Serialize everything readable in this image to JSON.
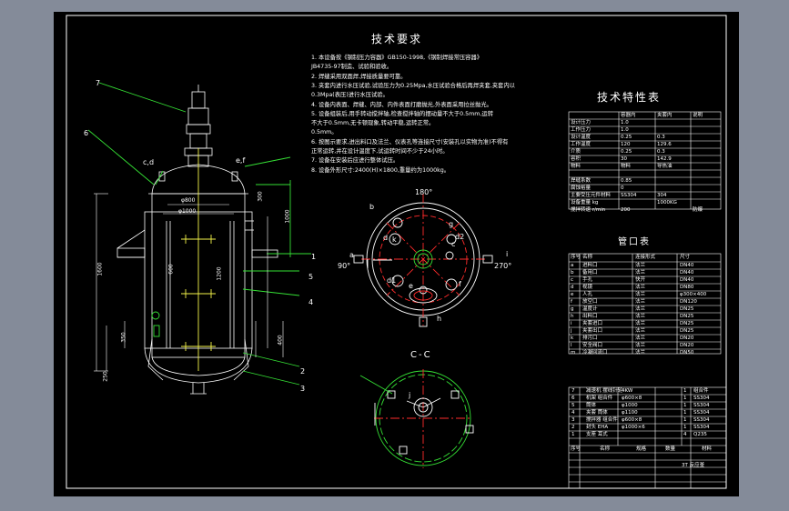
{
  "drawing": {
    "tech_req_title": "技术要求",
    "tech_req_lines": [
      "1. 本设备按《钢制压力容器》GB150-1998,《钢制焊接常压容器》",
      "JB4735-97制造、试验和验收。",
      "2. 焊缝采用双面焊,焊接质量要可靠。",
      "3. 夹套内进行水压试验,试验压力为0.25Mpa,水压试验合格后再焊夹套,夹套内以",
      "0.3Mpa(表压)进行水压试验。",
      "4. 设备内表面、焊缝、内部、内件表面打磨抛光,外表面采用拉丝抛光。",
      "5. 设备组装后,用手转动搅拌轴,检查搅拌轴的摆动量不大于0.5mm,运转",
      "不大于0.5mm,无卡顿现象,转动平稳,运转正常。",
      "0.5mm。",
      "6. 按图示要求,进出料口及法兰、仪表孔等连接尺寸(安装孔以实物为准)不得有",
      "正常运转,并在设计温度下,试运转时间不少于24小时。",
      "7. 设备在安装后应进行整体试压。",
      "8. 设备外形尺寸:2400(H)×1800,重量约为1000kg。"
    ],
    "spec_title": "技术特性表",
    "spec_header": [
      "",
      "容器内",
      "夹套内",
      "说明"
    ],
    "spec_rows": [
      [
        "设计压力",
        "1.0",
        "",
        ""
      ],
      [
        "工作压力",
        "1.0",
        "",
        ""
      ],
      [
        "设计温度",
        "0.25",
        "0.3",
        ""
      ],
      [
        "工作温度",
        "120",
        "129.6",
        ""
      ],
      [
        "介质",
        "0.25",
        "0.3",
        ""
      ],
      [
        "容积",
        "30",
        "142.9",
        ""
      ],
      [
        "物料",
        "物料",
        "导热油",
        ""
      ],
      [
        "",
        "",
        "",
        ""
      ],
      [
        "焊缝系数",
        "0.85",
        "",
        ""
      ],
      [
        "腐蚀裕量",
        "0",
        "",
        ""
      ],
      [
        "主要受压元件材料",
        "SS304",
        "304",
        ""
      ],
      [
        "设备重量 kg",
        "",
        "1000KG",
        ""
      ],
      [
        "搅拌转速 r/min",
        "200",
        "",
        "防爆"
      ]
    ],
    "nozzle_title": "管口表",
    "nozzle_header": [
      "序号",
      "名称",
      "连接形式",
      "尺寸"
    ],
    "nozzle_rows": [
      [
        "a",
        "进料口",
        "法兰",
        "DN40"
      ],
      [
        "b",
        "备用口",
        "法兰",
        "DN40"
      ],
      [
        "c",
        "手孔",
        "快开",
        "DN40"
      ],
      [
        "d",
        "视镜",
        "法兰",
        "DN80"
      ],
      [
        "e",
        "人孔",
        "法兰",
        "φ300×400"
      ],
      [
        "f",
        "放空口",
        "法兰",
        "DN120"
      ],
      [
        "g",
        "温度计",
        "法兰",
        "DN25"
      ],
      [
        "h",
        "出料口",
        "法兰",
        "DN25"
      ],
      [
        "i",
        "夹套进口",
        "法兰",
        "DN25"
      ],
      [
        "j",
        "夹套出口",
        "法兰",
        "DN25"
      ],
      [
        "k",
        "排污口",
        "法兰",
        "DN20"
      ],
      [
        "l",
        "安全阀口",
        "法兰",
        "DN20"
      ],
      [
        "m",
        "冷凝回流口",
        "法兰",
        "DN50"
      ]
    ],
    "parts_rows": [
      [
        "7",
        "减速机 摆线针轮",
        "4KW",
        "1",
        "组合件"
      ],
      [
        "6",
        "机架 组合件",
        "φ600×8",
        "1",
        "SS304"
      ],
      [
        "5",
        "筒体",
        "φ1000",
        "1",
        "SS304"
      ],
      [
        "4",
        "夹套 筒体",
        "φ1100",
        "1",
        "SS304"
      ],
      [
        "3",
        "搅拌器 组合件",
        "φ600×8",
        "1",
        "SS304"
      ],
      [
        "2",
        "封头 EHA",
        "φ1000×6",
        "1",
        "SS304"
      ],
      [
        "1",
        "支座 耳式",
        "",
        "4",
        "Q235"
      ]
    ],
    "title_block": {
      "col1": "序号",
      "col2": "名称",
      "col3": "规格",
      "col4": "数量",
      "col5": "材料",
      "name": "3T 反应釜"
    },
    "views": {
      "section_label": "C-C",
      "top_angles": [
        "180°",
        "90°",
        "270°"
      ],
      "nozzle_letters": [
        "a",
        "b",
        "c",
        "d",
        "d1",
        "d2",
        "e",
        "f",
        "g",
        "h",
        "i",
        "j",
        "k"
      ],
      "callouts": [
        "1",
        "2",
        "3",
        "4",
        "5",
        "6",
        "7"
      ],
      "leader_top_left": "c,d",
      "leader_top_right": "e,f"
    },
    "dimensions": [
      "φ800",
      "φ1000",
      "1600",
      "1000",
      "1200",
      "600",
      "350",
      "400",
      "250",
      "300"
    ],
    "colors": {
      "background": "#000000",
      "line": "#ffffff",
      "center": "#ff2b2b",
      "green": "#35e035",
      "yellow": "#f5f54a",
      "frame_bg": "#848b99"
    }
  }
}
